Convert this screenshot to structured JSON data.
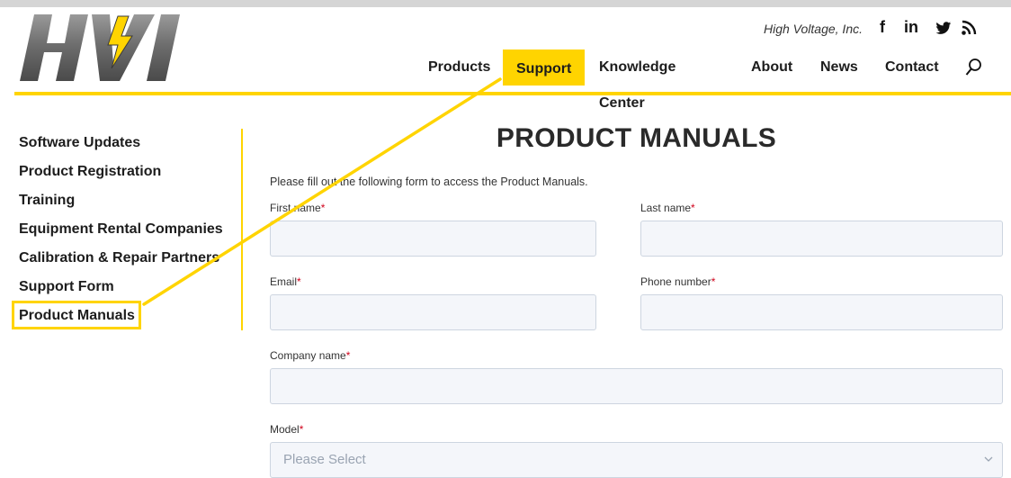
{
  "header": {
    "logo_text": "HVI",
    "tagline": "High Voltage, Inc.",
    "social": {
      "facebook": "f",
      "linkedin": "in",
      "twitter": "🐦",
      "rss": "rss-feed"
    }
  },
  "nav": {
    "items": [
      "Products",
      "Support",
      "Knowledge Center",
      "About",
      "News",
      "Contact"
    ],
    "active": "Support"
  },
  "sidebar": {
    "items": [
      "Software Updates",
      "Product Registration",
      "Training",
      "Equipment Rental Companies",
      "Calibration & Repair Partners",
      "Support Form",
      "Product Manuals"
    ],
    "active": "Product Manuals"
  },
  "page": {
    "title": "PRODUCT MANUALS",
    "intro": "Please fill out the following form to access the Product Manuals."
  },
  "form": {
    "required_mark": "*",
    "first_name_label": "First name",
    "last_name_label": "Last name",
    "email_label": "Email",
    "phone_label": "Phone number",
    "company_label": "Company name",
    "model_label": "Model",
    "model_value": "Please Select"
  },
  "colors": {
    "accent": "#ffd400",
    "required": "#d0021b",
    "input_bg": "#f4f6fa"
  }
}
